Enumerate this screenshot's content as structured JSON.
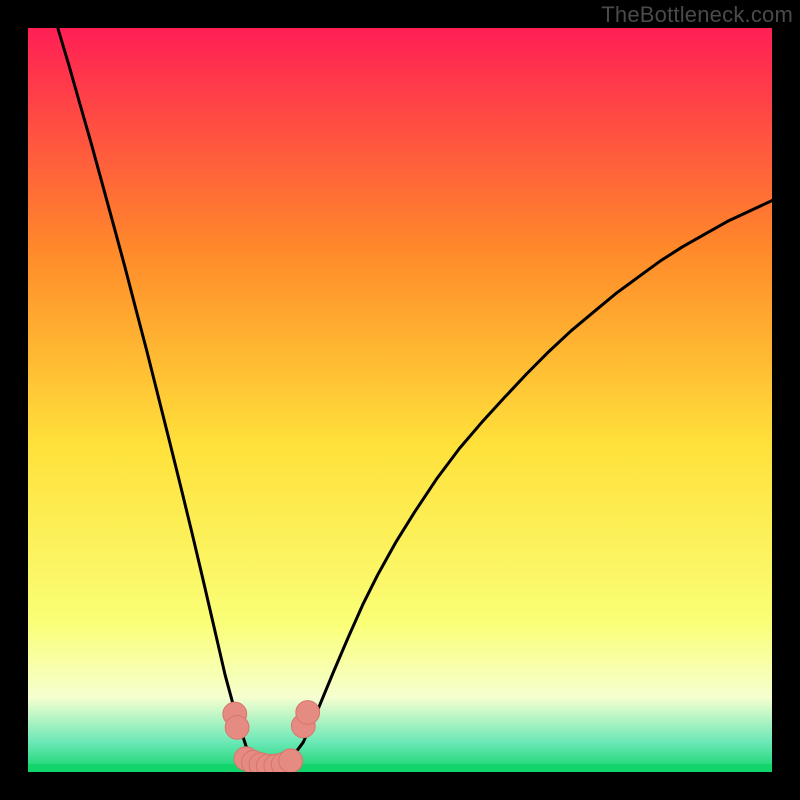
{
  "watermark": "TheBottleneck.com",
  "colors": {
    "frame": "#000000",
    "gradient_top": "#ff1f55",
    "gradient_upper_mid": "#ff8a2a",
    "gradient_mid": "#ffe13a",
    "gradient_lower_mid": "#faff77",
    "gradient_bottom_band": "#f6ffd0",
    "teal_band": "#6be8b7",
    "green_strip": "#11d46a",
    "curve": "#000000",
    "marker_fill": "#e58b82",
    "marker_stroke": "#d9756d"
  },
  "chart_data": {
    "type": "line",
    "title": "",
    "xlabel": "",
    "ylabel": "",
    "xlim": [
      0,
      1
    ],
    "ylim": [
      0,
      1
    ],
    "x": [
      0.04,
      0.055,
      0.07,
      0.085,
      0.1,
      0.115,
      0.13,
      0.145,
      0.16,
      0.175,
      0.19,
      0.205,
      0.22,
      0.235,
      0.25,
      0.265,
      0.28,
      0.293,
      0.307,
      0.32,
      0.333,
      0.35,
      0.37,
      0.39,
      0.41,
      0.43,
      0.45,
      0.47,
      0.495,
      0.52,
      0.55,
      0.58,
      0.61,
      0.64,
      0.67,
      0.7,
      0.73,
      0.76,
      0.79,
      0.82,
      0.85,
      0.88,
      0.91,
      0.94,
      0.97,
      1.0
    ],
    "values": [
      1.0,
      0.95,
      0.897,
      0.845,
      0.79,
      0.735,
      0.68,
      0.622,
      0.565,
      0.505,
      0.445,
      0.385,
      0.323,
      0.26,
      0.195,
      0.13,
      0.075,
      0.035,
      0.013,
      0.006,
      0.006,
      0.013,
      0.04,
      0.085,
      0.133,
      0.18,
      0.225,
      0.265,
      0.31,
      0.35,
      0.395,
      0.435,
      0.47,
      0.503,
      0.535,
      0.565,
      0.593,
      0.618,
      0.643,
      0.665,
      0.687,
      0.706,
      0.723,
      0.74,
      0.754,
      0.768
    ],
    "markers": {
      "left_cluster": [
        {
          "x": 0.278,
          "y": 0.078
        },
        {
          "x": 0.281,
          "y": 0.06
        }
      ],
      "right_cluster": [
        {
          "x": 0.37,
          "y": 0.062
        },
        {
          "x": 0.376,
          "y": 0.08
        }
      ],
      "bottom_line": [
        {
          "x": 0.293,
          "y": 0.018
        },
        {
          "x": 0.303,
          "y": 0.013
        },
        {
          "x": 0.313,
          "y": 0.01
        },
        {
          "x": 0.323,
          "y": 0.008
        },
        {
          "x": 0.333,
          "y": 0.008
        },
        {
          "x": 0.343,
          "y": 0.01
        },
        {
          "x": 0.353,
          "y": 0.015
        }
      ]
    },
    "marker_radius_norm": 0.016
  }
}
